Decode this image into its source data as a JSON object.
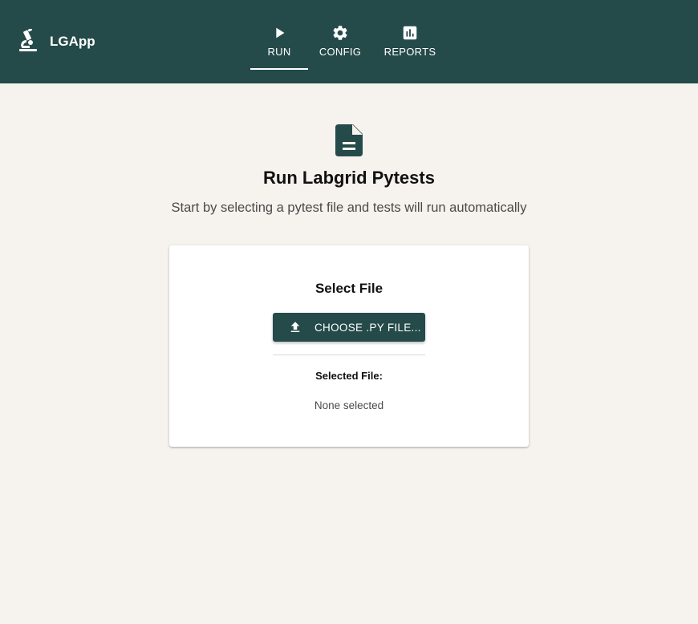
{
  "header": {
    "brand_icon": "microscope-icon",
    "brand_name": "LGApp",
    "tabs": [
      {
        "label": "RUN",
        "icon": "play-icon",
        "active": true
      },
      {
        "label": "CONFIG",
        "icon": "gear-icon",
        "active": false
      },
      {
        "label": "REPORTS",
        "icon": "bar-chart-icon",
        "active": false
      }
    ]
  },
  "main": {
    "hero_icon": "document-icon",
    "title": "Run Labgrid Pytests",
    "subtitle": "Start by selecting a pytest file and tests will run automatically"
  },
  "card": {
    "title": "Select File",
    "button_icon": "upload-icon",
    "button_label": "CHOOSE .PY FILE...",
    "selected_label": "Selected File:",
    "selected_value": "None selected"
  },
  "colors": {
    "primary": "#254a4a",
    "background": "#f6f2ed",
    "card": "#ffffff",
    "text_muted": "#4a4a4a"
  }
}
